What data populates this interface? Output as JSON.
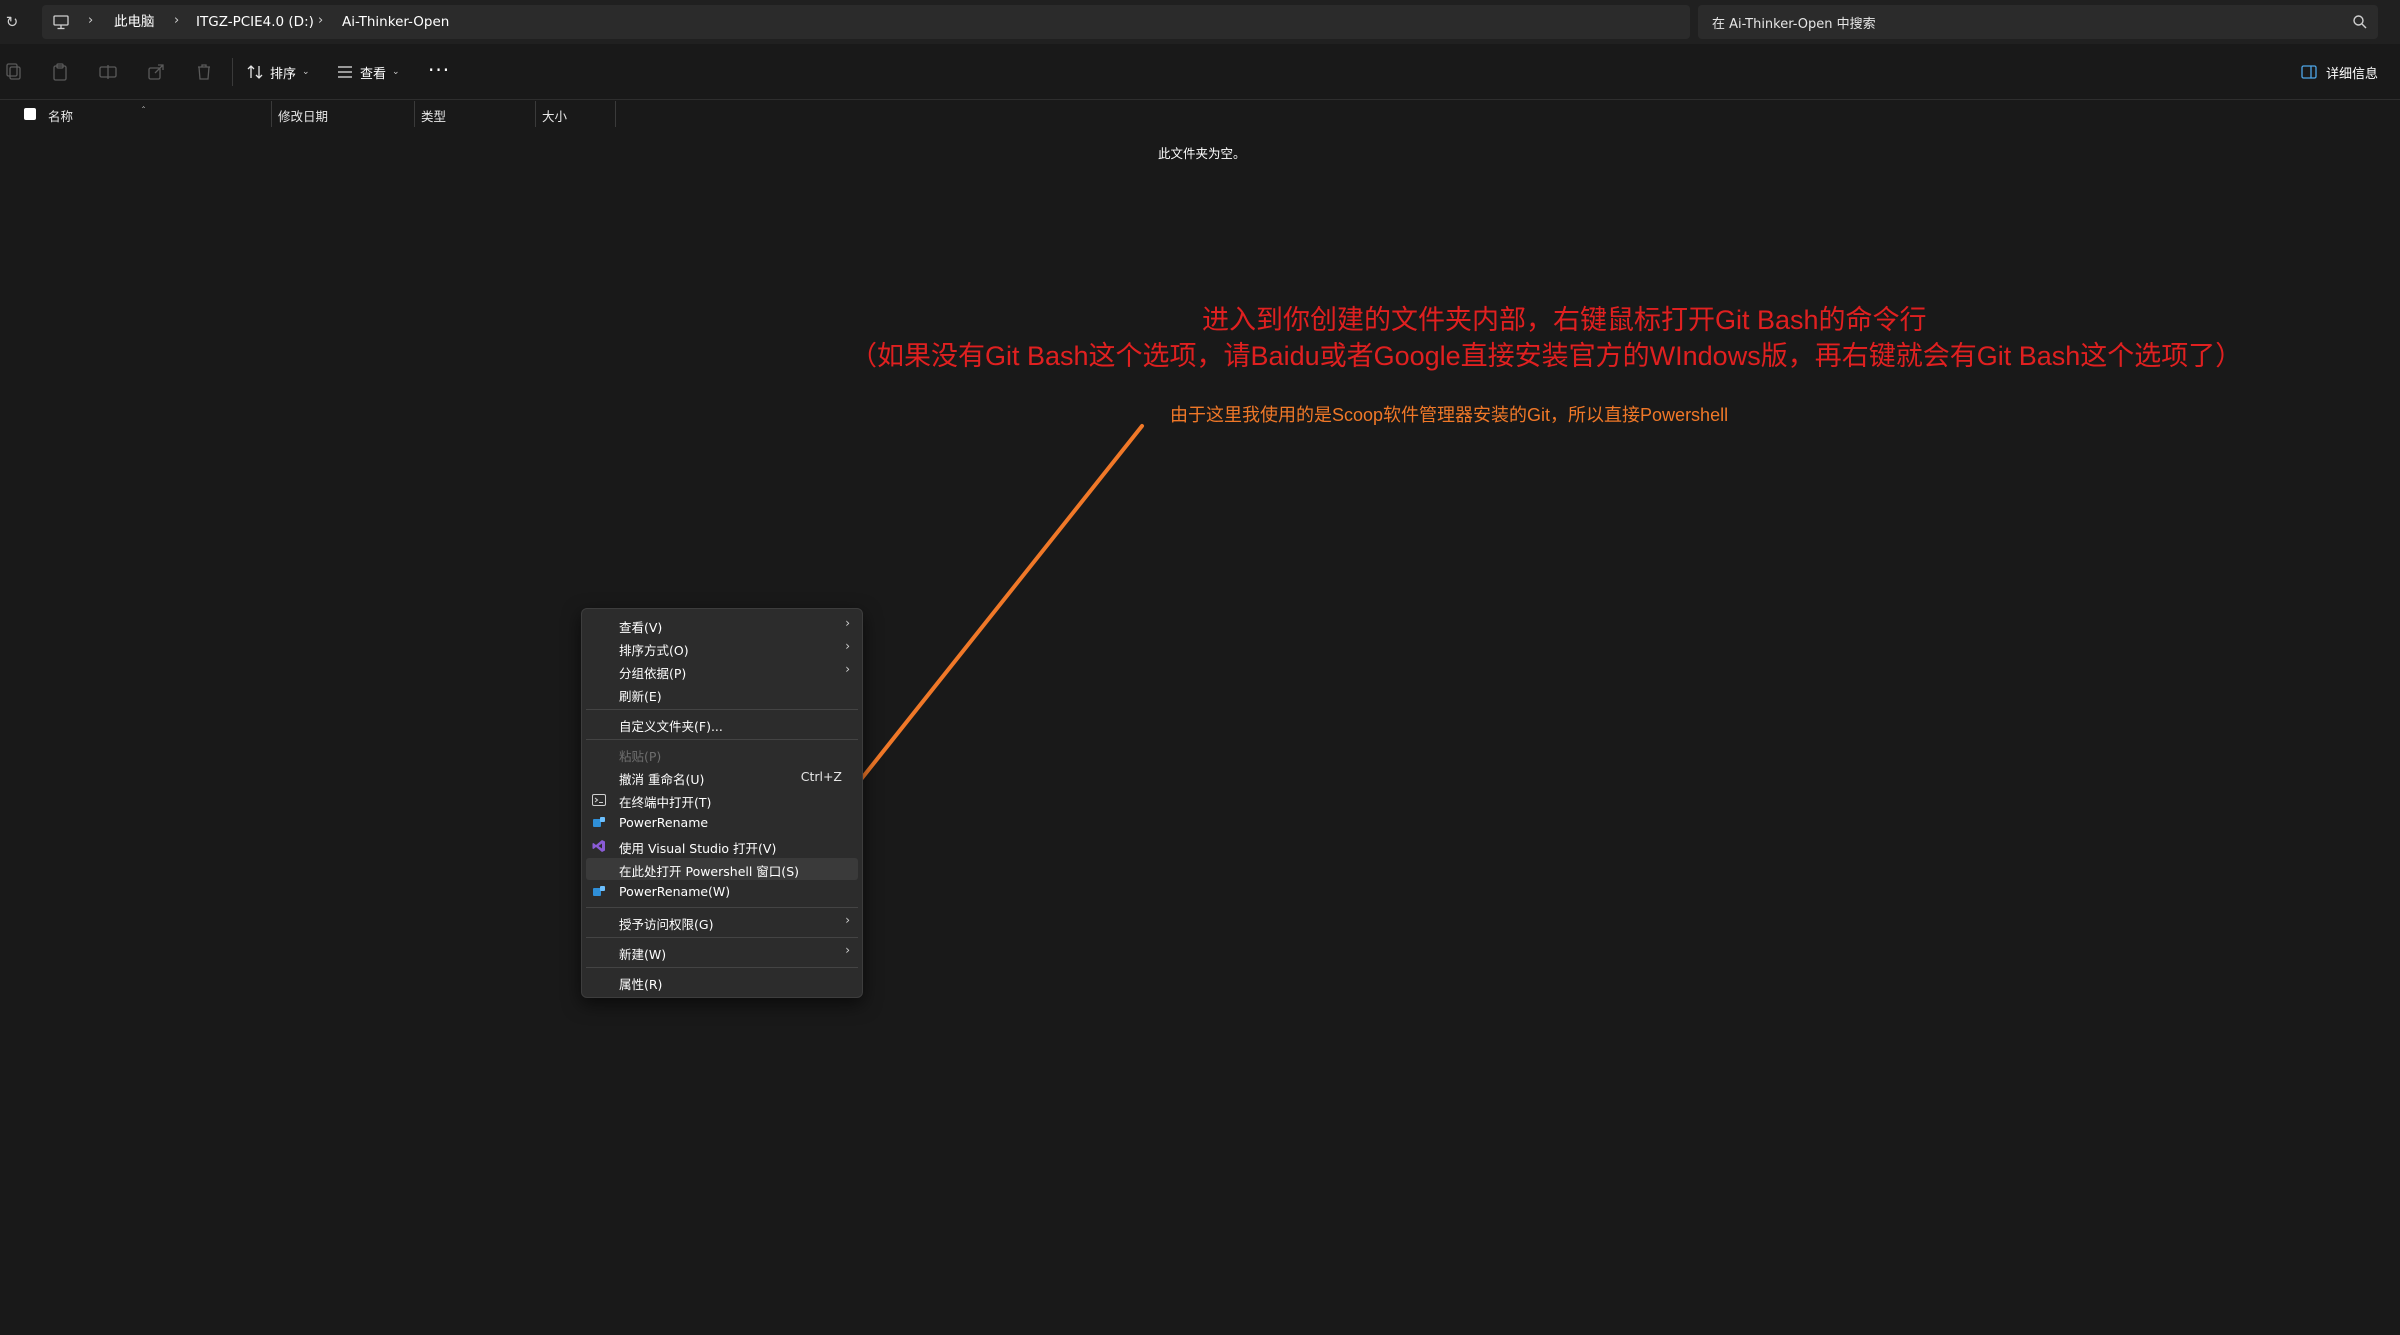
{
  "breadcrumb": {
    "items": [
      "此电脑",
      "ITGZ-PCIE4.0 (D:)",
      "Ai-Thinker-Open"
    ]
  },
  "search": {
    "placeholder": "在 Ai-Thinker-Open 中搜索"
  },
  "toolbar": {
    "sort_label": "排序",
    "view_label": "查看",
    "more_label": "···",
    "details_label": "详细信息"
  },
  "columns": [
    "名称",
    "修改日期",
    "类型",
    "大小"
  ],
  "empty_message": "此文件夹为空。",
  "annotations": {
    "line1": "进入到你创建的文件夹内部，右键鼠标打开Git Bash的命令行",
    "line2": "（如果没有Git Bash这个选项，请Baidu或者Google直接安装官方的WIndows版，再右键就会有Git Bash这个选项了）",
    "note": "由于这里我使用的是Scoop软件管理器安装的Git，所以直接Powershell",
    "red_color": "#e02020",
    "orange_color": "#f07828"
  },
  "context_menu": {
    "items": [
      {
        "label": "查看(V)",
        "submenu": true
      },
      {
        "label": "排序方式(O)",
        "submenu": true
      },
      {
        "label": "分组依据(P)",
        "submenu": true
      },
      {
        "label": "刷新(E)"
      },
      {
        "label": "自定义文件夹(F)..."
      },
      {
        "label": "粘贴(P)",
        "disabled": true
      },
      {
        "label": "撤消 重命名(U)",
        "accelerator": "Ctrl+Z"
      },
      {
        "label": "在终端中打开(T)",
        "icon": "terminal-icon"
      },
      {
        "label": "PowerRename",
        "icon": "powerrename-icon"
      },
      {
        "label": "使用 Visual Studio 打开(V)",
        "icon": "visual-studio-icon"
      },
      {
        "label": "在此处打开 Powershell 窗口(S)",
        "highlighted": true
      },
      {
        "label": "PowerRename(W)",
        "icon": "powerrename-icon"
      },
      {
        "label": "授予访问权限(G)",
        "submenu": true
      },
      {
        "label": "新建(W)",
        "submenu": true
      },
      {
        "label": "属性(R)"
      }
    ]
  },
  "colors": {
    "background": "#191919",
    "menu_background": "#2c2c2c",
    "accent_blue": "#2f8fd8",
    "vs_purple": "#8a5bd6"
  }
}
